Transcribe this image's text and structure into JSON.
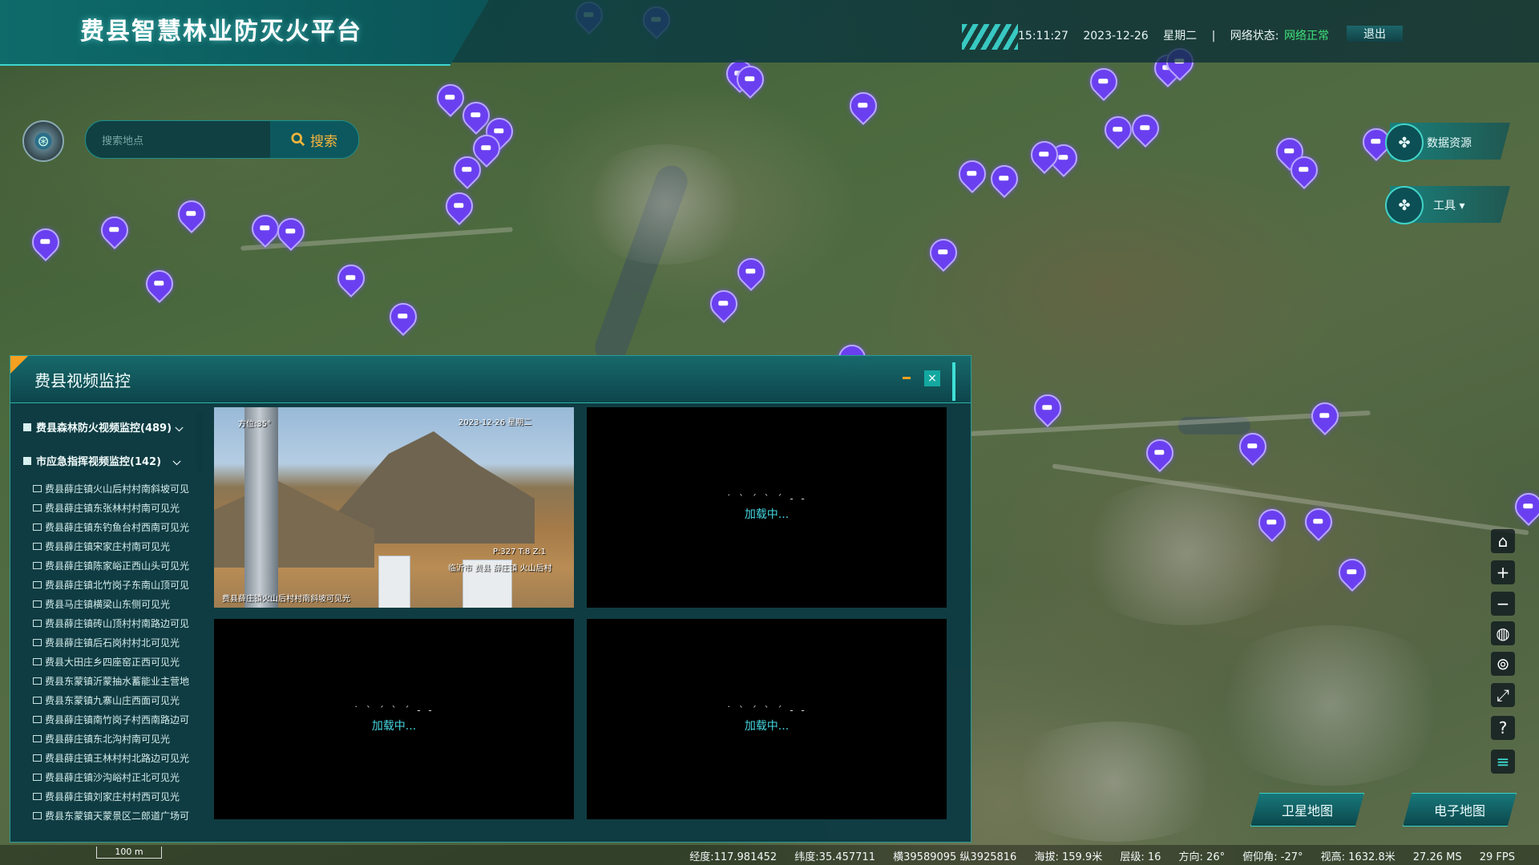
{
  "header": {
    "title": "费县智慧林业防灭火平台",
    "time": "15:11:27",
    "date": "2023-12-26",
    "weekday": "星期二",
    "separator": "|",
    "network_label": "网络状态:",
    "network_value": "网络正常",
    "exit_label": "退出",
    "network_ok_color": "#3ee07a"
  },
  "search": {
    "placeholder": "搜索地点",
    "button_label": "搜索",
    "button_icon": "search-icon"
  },
  "right_panel": {
    "data_resources_label": "数据资源",
    "tools_label": "工具",
    "tools_caret": "▾"
  },
  "map_tools": [
    "home-icon",
    "zoom-in-icon",
    "zoom-out-icon",
    "globe-icon",
    "vr-icon",
    "fullscreen-icon",
    "help-icon",
    "layers-icon"
  ],
  "map_type": {
    "satellite_label": "卫星地图",
    "electronic_label": "电子地图"
  },
  "status_bar": {
    "scale": "100 m",
    "longitude": "经度:117.981452",
    "latitude": "纬度:35.457711",
    "projection": "横39589095 纵3925816",
    "altitude": "海拔: 159.9米",
    "level": "层级: 16",
    "heading": "方向: 26°",
    "pitch": "俯仰角: -27°",
    "view_height": "视高: 1632.8米",
    "frame_ms": "27.26 MS",
    "fps": "29 FPS"
  },
  "video_panel": {
    "title": "费县视频监控",
    "close_label": "×",
    "groups": [
      {
        "label": "费县森林防火视频监控(489)",
        "caret": "⌵"
      },
      {
        "label": "市应急指挥视频监控(142)",
        "caret": "⌵"
      }
    ],
    "cameras": [
      "费县薛庄镇火山后村村南斜坡可见",
      "费县薛庄镇东张林村村南可见光",
      "费县薛庄镇东钓鱼台村西南可见光",
      "费县薛庄镇宋家庄村南可见光",
      "费县薛庄镇陈家峪正西山头可见光",
      "费县薛庄镇北竹岗子东南山顶可见",
      "费县马庄镇横梁山东侧可见光",
      "费县薛庄镇砖山顶村村南路边可见",
      "费县薛庄镇后石岗村村北可见光",
      "费县大田庄乡四座窑正西可见光",
      "费县东蒙镇沂蒙抽水蓄能业主营地",
      "费县东蒙镇九寨山庄西面可见光",
      "费县薛庄镇南竹岗子村西南路边可",
      "费县薛庄镇东北沟村南可见光",
      "费县薛庄镇王林村村北路边可见光",
      "费县薛庄镇沙沟峪村正北可见光",
      "费县薛庄镇刘家庄村村西可见光",
      "费县东蒙镇天蒙景区二郎道广场可"
    ],
    "feed_overlay": {
      "timestamp": "2023-12-26 星期二",
      "ptz": "P:327 T:8 Z:1",
      "angle": "方位:35°",
      "caption": "费县薛庄镇火山后村村南斜坡可见光",
      "location": "临沂市 费县 薛庄镇 火山后村"
    },
    "loading_dots": "˙ ˋ ˊ ˋ ˊ - -",
    "loading_text": "加载中..."
  }
}
